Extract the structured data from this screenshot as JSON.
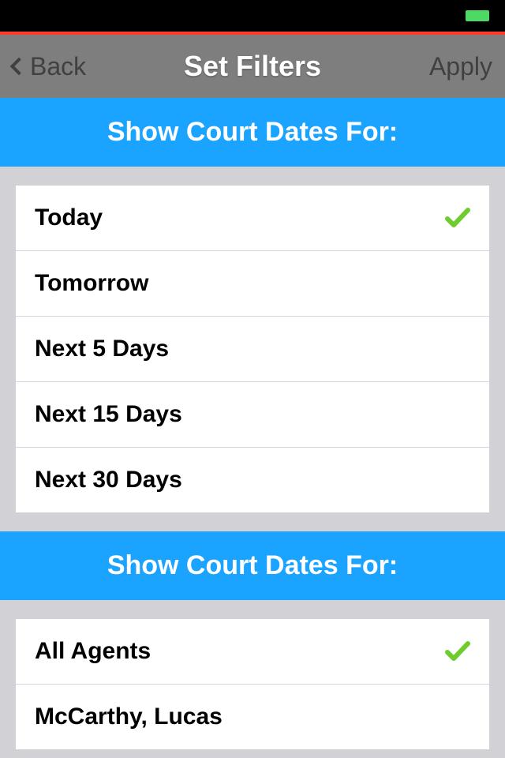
{
  "nav": {
    "back_label": "Back",
    "title": "Set Filters",
    "apply_label": "Apply"
  },
  "sections": [
    {
      "header": "Show Court Dates For:",
      "items": [
        {
          "label": "Today",
          "selected": true
        },
        {
          "label": "Tomorrow",
          "selected": false
        },
        {
          "label": "Next 5 Days",
          "selected": false
        },
        {
          "label": "Next 15 Days",
          "selected": false
        },
        {
          "label": "Next 30 Days",
          "selected": false
        }
      ]
    },
    {
      "header": "Show Court Dates For:",
      "items": [
        {
          "label": "All Agents",
          "selected": true
        },
        {
          "label": "McCarthy, Lucas",
          "selected": false
        }
      ]
    }
  ]
}
